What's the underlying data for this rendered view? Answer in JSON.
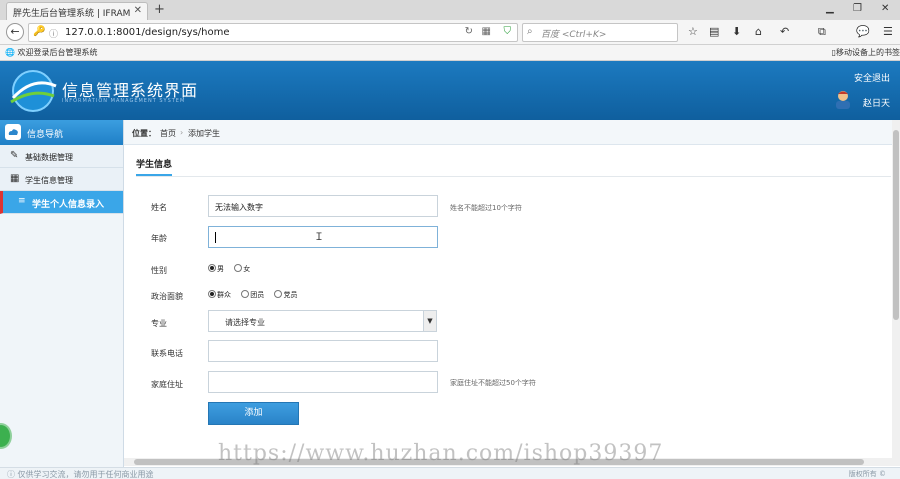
{
  "browser": {
    "tab_title": "胖先生后台管理系统 | IFRAM...",
    "tab_close": "✕",
    "new_tab": "+",
    "url": "127.0.0.1:8001/design/sys/home",
    "search_placeholder": "百度 <Ctrl+K>",
    "bookmark": "欢迎登录后台管理系统",
    "bookmark_right": "移动设备上的书签"
  },
  "header": {
    "title": "信息管理系统界面",
    "subtitle": "INFORMATION MANAGEMENT SYSTEM",
    "logout": "安全退出",
    "user": "赵日天"
  },
  "sidebar": {
    "header": "信息导航",
    "items": [
      {
        "label": "基础数据管理",
        "icon": "edit-icon"
      },
      {
        "label": "学生信息管理",
        "icon": "calendar-icon"
      },
      {
        "label": "学生个人信息录入",
        "icon": "list-icon",
        "active": true
      }
    ]
  },
  "breadcrumb": {
    "label": "位置：",
    "home": "首页",
    "sep": "›",
    "current": "添加学生"
  },
  "form": {
    "section": "学生信息",
    "name_label": "姓名",
    "name_value": "无法输入数字",
    "name_hint": "姓名不能超过10个字符",
    "age_label": "年龄",
    "gender_label": "性别",
    "gender_options": [
      "男",
      "女"
    ],
    "politics_label": "政治面貌",
    "politics_options": [
      "群众",
      "团员",
      "党员"
    ],
    "major_label": "专业",
    "major_value": "请选择专业",
    "phone_label": "联系电话",
    "address_label": "家庭住址",
    "address_hint": "家庭住址不能超过50个字符",
    "submit": "添加"
  },
  "status": {
    "left": "仅供学习交流，请勿用于任何商业用途",
    "right": "版权所有 ©"
  },
  "watermark": "https://www.huzhan.com/ishop39397",
  "colors": {
    "header": "#1c7ac0",
    "accent": "#3aa6e8",
    "active_marker": "#dd3333"
  }
}
